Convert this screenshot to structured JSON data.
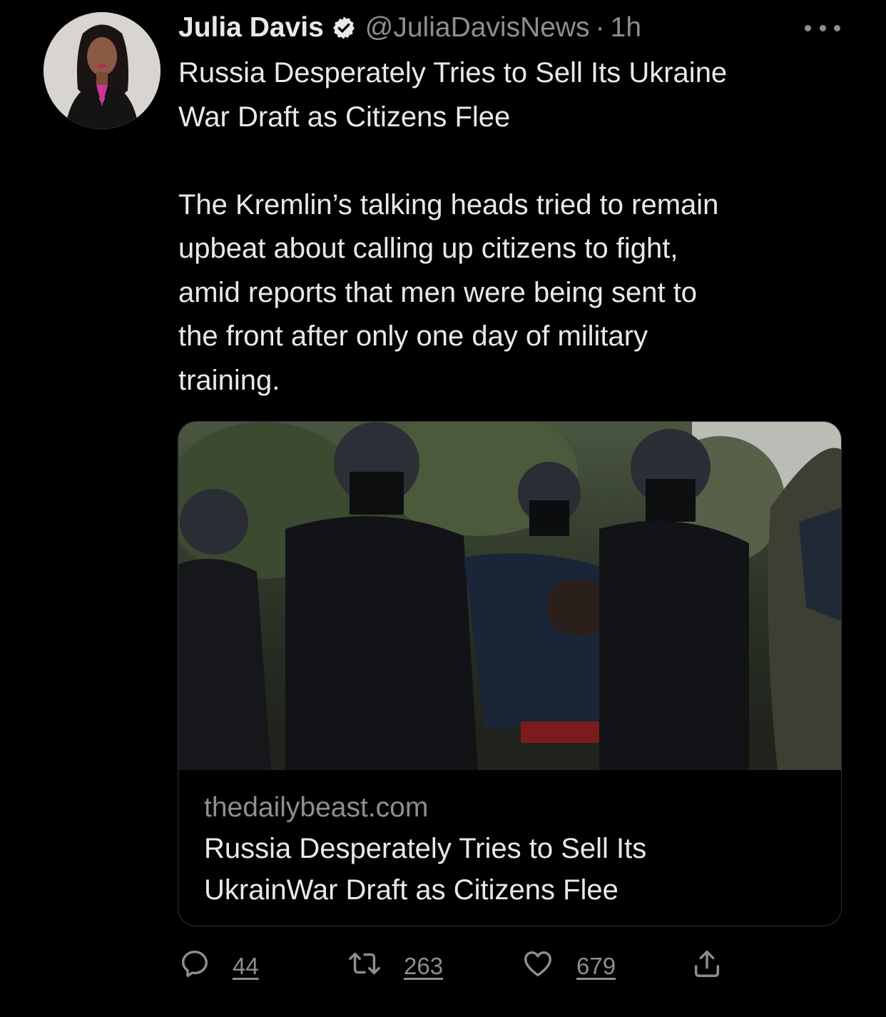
{
  "tweet": {
    "author": {
      "display_name": "Julia Davis",
      "handle": "@JuliaDavisNews",
      "verified": true,
      "avatar_icon": "profile-photo"
    },
    "separator": "·",
    "time": "1h",
    "more_icon": "ellipsis-icon",
    "text_lines": [
      "Russia Desperately Tries to Sell Its Ukraine",
      "War Draft as Citizens Flee",
      "",
      "The Kremlin’s talking heads tried to remain",
      "upbeat about calling up citizens to fight,",
      "amid reports that men were being sent to",
      "the front after only one day of military",
      "training."
    ],
    "link_card": {
      "domain": "thedailybeast.com",
      "title_lines": [
        "Russia Desperately Tries to Sell Its",
        "UkrainWar Draft as Citizens Flee"
      ]
    },
    "actions": {
      "reply": {
        "icon": "reply-icon",
        "count": "44"
      },
      "retweet": {
        "icon": "retweet-icon",
        "count": "263"
      },
      "like": {
        "icon": "heart-icon",
        "count": "679"
      },
      "share": {
        "icon": "share-icon"
      }
    }
  },
  "colors": {
    "background": "#000000",
    "text": "#e7e9ea",
    "secondary": "#8b8f93",
    "border": "#2f3336"
  }
}
